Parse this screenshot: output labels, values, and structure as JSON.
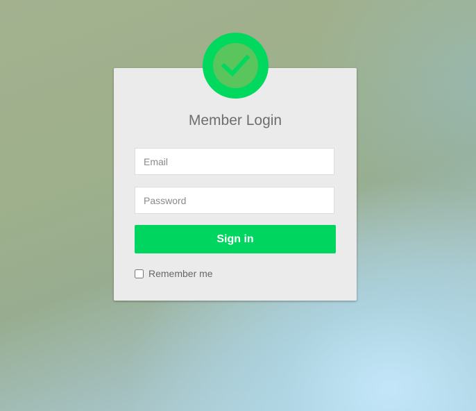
{
  "login": {
    "title": "Member Login",
    "email_placeholder": "Email",
    "password_placeholder": "Password",
    "submit_label": "Sign in",
    "remember_label": "Remember me",
    "remember_checked": false,
    "badge_icon": "checkmark-icon"
  },
  "colors": {
    "accent_green": "#00d65f",
    "badge_inner": "#5ac55c",
    "card_bg": "#ebebeb",
    "title_text": "#6e6e6e"
  }
}
